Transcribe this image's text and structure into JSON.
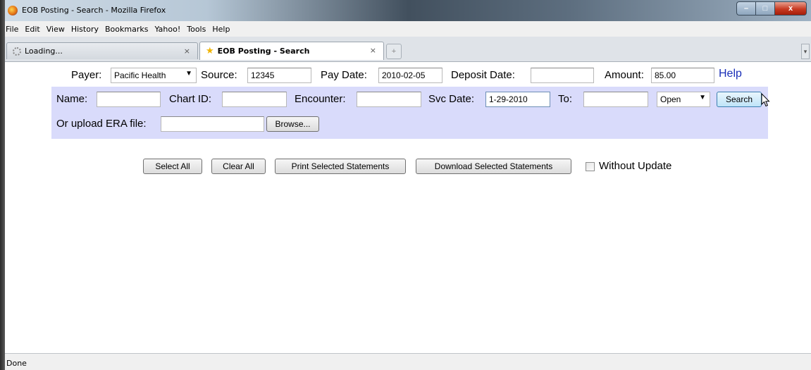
{
  "window": {
    "title": "EOB Posting - Search - Mozilla Firefox",
    "controls": {
      "minimize": "–",
      "maximize": "□",
      "close": "x"
    }
  },
  "menu": [
    "File",
    "Edit",
    "View",
    "History",
    "Bookmarks",
    "Yahoo!",
    "Tools",
    "Help"
  ],
  "tabs": [
    {
      "label": "Loading...",
      "close": "×",
      "icon": "spinner-icon",
      "active": false
    },
    {
      "label": "EOB Posting - Search",
      "close": "×",
      "icon": "star-icon",
      "active": true
    }
  ],
  "new_tab": "+",
  "tab_scroll": "▾",
  "form": {
    "payer_label": "Payer:",
    "payer_value": "Pacific Health",
    "source_label": "Source:",
    "source_value": "12345",
    "pay_date_label": "Pay Date:",
    "pay_date_value": "2010-02-05",
    "deposit_date_label": "Deposit Date:",
    "deposit_date_value": "",
    "amount_label": "Amount:",
    "amount_value": "85.00",
    "help_link": "Help",
    "name_label": "Name:",
    "name_value": "",
    "chart_id_label": "Chart ID:",
    "chart_id_value": "",
    "encounter_label": "Encounter:",
    "encounter_value": "",
    "svc_date_label": "Svc Date:",
    "svc_date_value": "1-29-2010",
    "to_label": "To:",
    "to_value": "",
    "status_value": "Open",
    "search_button": "Search",
    "upload_label": "Or upload ERA file:",
    "upload_value": "",
    "browse_button": "Browse..."
  },
  "actions": {
    "select_all": "Select All",
    "clear_all": "Clear All",
    "print_selected": "Print Selected Statements",
    "download_selected": "Download Selected Statements",
    "without_update_label": "Without Update",
    "without_update_checked": false
  },
  "status": "Done",
  "colors": {
    "panel_bg": "#d9dbfb",
    "help_link": "#1a2fb8",
    "close_button": "#c83a22"
  }
}
